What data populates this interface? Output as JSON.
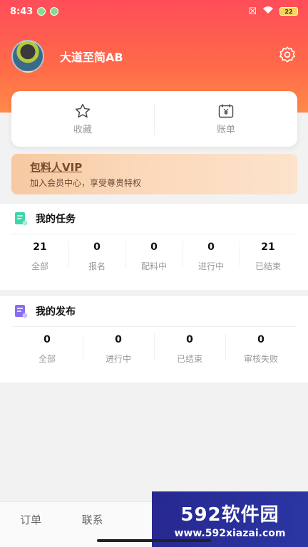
{
  "status_bar": {
    "time": "8:43",
    "battery": "22"
  },
  "profile": {
    "username": "大道至简AB"
  },
  "quick": {
    "items": [
      {
        "label": "收藏",
        "icon": "star-icon"
      },
      {
        "label": "账单",
        "icon": "bill-icon"
      }
    ]
  },
  "vip": {
    "title": "包料人VIP",
    "subtitle": "加入会员中心，享受尊贵特权"
  },
  "tasks": {
    "title": "我的任务",
    "stats": [
      {
        "value": "21",
        "label": "全部"
      },
      {
        "value": "0",
        "label": "报名"
      },
      {
        "value": "0",
        "label": "配料中"
      },
      {
        "value": "0",
        "label": "进行中"
      },
      {
        "value": "21",
        "label": "已结束"
      }
    ]
  },
  "publish": {
    "title": "我的发布",
    "stats": [
      {
        "value": "0",
        "label": "全部"
      },
      {
        "value": "0",
        "label": "进行中"
      },
      {
        "value": "0",
        "label": "已结束"
      },
      {
        "value": "0",
        "label": "审核失败"
      }
    ]
  },
  "nav": {
    "items": [
      "订单",
      "联系"
    ]
  },
  "watermark": {
    "brand": "592软件园",
    "url": "www.592xiazai.com"
  },
  "colors": {
    "accent": "#ff5a4f",
    "vip_text": "#7a4b2b"
  }
}
